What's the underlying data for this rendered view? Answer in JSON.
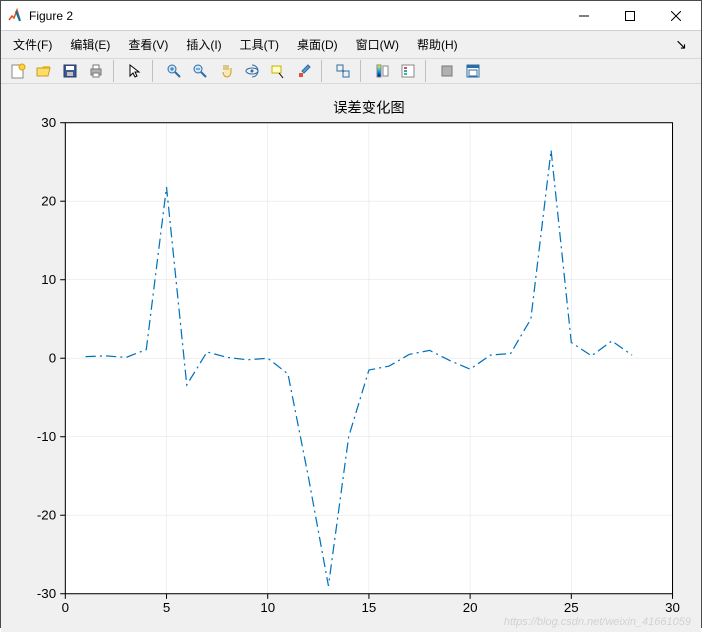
{
  "window": {
    "title": "Figure 2"
  },
  "menubar": {
    "file": "文件(F)",
    "edit": "编辑(E)",
    "view": "查看(V)",
    "insert": "插入(I)",
    "tools": "工具(T)",
    "desktop": "桌面(D)",
    "window": "窗口(W)",
    "help": "帮助(H)"
  },
  "toolbar": {
    "icons": [
      "new-figure",
      "open",
      "save",
      "print",
      "sep",
      "pointer",
      "sep",
      "zoom-in",
      "zoom-out",
      "pan",
      "rotate-3d",
      "data-cursor",
      "brush",
      "sep",
      "link",
      "sep",
      "insert-colorbar",
      "insert-legend",
      "sep",
      "hide-plot",
      "dock"
    ]
  },
  "watermark": "https://blog.csdn.net/weixin_41661059",
  "chart_data": {
    "type": "line",
    "title": "误差变化图",
    "xlabel": "",
    "ylabel": "",
    "xlim": [
      0,
      30
    ],
    "ylim": [
      -30,
      30
    ],
    "xticks": [
      0,
      5,
      10,
      15,
      20,
      25,
      30
    ],
    "yticks": [
      -30,
      -20,
      -10,
      0,
      10,
      20,
      30
    ],
    "grid": true,
    "line_style": "dash-dot",
    "color": "#0072bd",
    "x": [
      1,
      2,
      3,
      4,
      5,
      6,
      7,
      8,
      9,
      10,
      11,
      12,
      13,
      14,
      15,
      16,
      17,
      18,
      19,
      20,
      21,
      22,
      23,
      24,
      25,
      26,
      27,
      28
    ],
    "y": [
      0.2,
      0.3,
      0.1,
      1.1,
      21.8,
      -3.4,
      0.8,
      0.1,
      -0.2,
      0.0,
      -2.0,
      -15.0,
      -29.0,
      -10.0,
      -1.5,
      -1.0,
      0.5,
      1.0,
      -0.3,
      -1.4,
      0.4,
      0.6,
      5.0,
      26.5,
      2.0,
      0.3,
      2.2,
      0.4
    ]
  }
}
